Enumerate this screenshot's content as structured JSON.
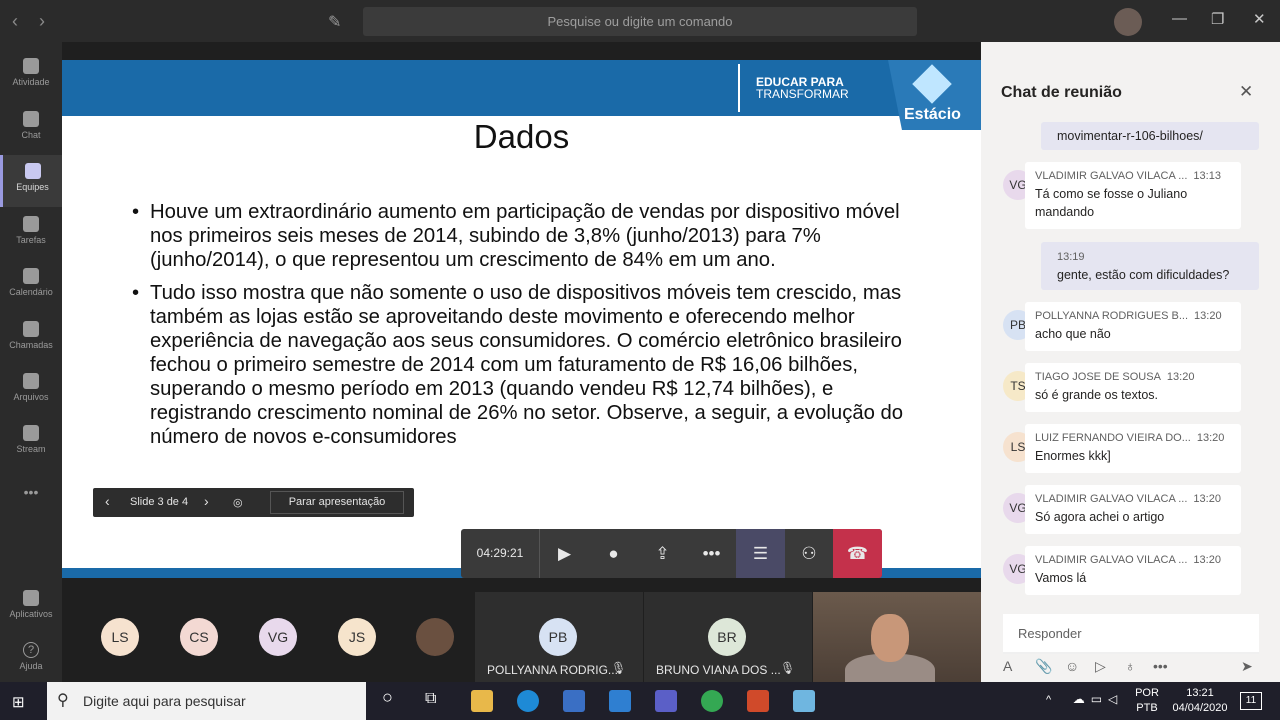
{
  "topbar": {
    "search_placeholder": "Pesquise ou digite um comando",
    "back": "‹",
    "forward": "›",
    "compose": "✎",
    "minimize": "—",
    "maximize": "❐",
    "close": "✕"
  },
  "rail": {
    "items": [
      {
        "label": "Atividade",
        "icon": "bell-icon"
      },
      {
        "label": "Chat",
        "icon": "chat-icon"
      },
      {
        "label": "Equipes",
        "icon": "teams-icon"
      },
      {
        "label": "Tarefas",
        "icon": "tasks-icon"
      },
      {
        "label": "Calendário",
        "icon": "calendar-icon"
      },
      {
        "label": "Chamadas",
        "icon": "phone-icon"
      },
      {
        "label": "Arquivos",
        "icon": "files-icon"
      },
      {
        "label": "Stream",
        "icon": "stream-icon"
      }
    ],
    "more": "•••",
    "apps": "Aplicativos",
    "help": "Ajuda",
    "help_glyph": "?"
  },
  "slide": {
    "brand_line1": "EDUCAR PARA",
    "brand_line2": "TRANSFORMAR",
    "logo_text": "Estácio",
    "title": "Dados",
    "bullet1": "Houve um extraordinário aumento em participação de vendas por dispositivo móvel nos primeiros seis meses de 2014, subindo de 3,8% (junho/2013) para 7% (junho/2014), o que representou um crescimento de 84% em um ano.",
    "bullet2": "Tudo isso mostra que não somente o uso de dispositivos móveis tem crescido, mas também as lojas estão se aproveitando deste movimento e oferecendo melhor experiência de navegação aos seus consumidores. O comércio eletrônico brasileiro fechou o primeiro semestre de 2014 com um faturamento de R$ 16,06 bilhões, superando o mesmo período em 2013 (quando vendeu R$ 12,74 bilhões), e registrando crescimento nominal de 26% no setor. Observe, a seguir, a evolução do número de novos e-consumidores"
  },
  "slide_controls": {
    "prev": "‹",
    "label": "Slide 3 de 4",
    "next": "›",
    "hide": "◎",
    "stop": "Parar apresentação"
  },
  "call_bar": {
    "timer": "04:29:21",
    "camera": "▶",
    "mic": "●",
    "share": "⇪",
    "more": "•••",
    "chat": "☰",
    "people": "⚇",
    "hangup": "☎"
  },
  "participants": {
    "circles": [
      {
        "initials": "LS",
        "color": "#f6e2cf"
      },
      {
        "initials": "CS",
        "color": "#f3d9d3"
      },
      {
        "initials": "VG",
        "color": "#e8d9ec"
      },
      {
        "initials": "JS",
        "color": "#f6e4cc"
      }
    ],
    "tiles": [
      {
        "initials": "PB",
        "name": "POLLYANNA RODRIG...",
        "color": "#d7e2f3"
      },
      {
        "initials": "BR",
        "name": "BRUNO VIANA DOS ...",
        "color": "#dde7d8"
      }
    ],
    "mute_glyph": "🎙"
  },
  "chat": {
    "title": "Chat de reunião",
    "close": "✕",
    "link_msg": "movimentar-r-106-bilhoes/",
    "messages": [
      {
        "initials": "VG",
        "author": "VLADIMIR GALVAO VILACA ...",
        "time": "13:13",
        "text": "Tá como se fosse o Juliano mandando",
        "color": "#e8d9ec"
      },
      {
        "initials": "PB",
        "author": "POLLYANNA RODRIGUES B...",
        "time": "13:20",
        "text": "acho que não",
        "color": "#d7e2f3"
      },
      {
        "initials": "TS",
        "author": "TIAGO JOSE DE SOUSA",
        "time": "13:20",
        "text": "só é grande os textos.",
        "color": "#f6e9c8"
      },
      {
        "initials": "LS",
        "author": "LUIZ FERNANDO VIEIRA DO...",
        "time": "13:20",
        "text": "Enormes kkk]",
        "color": "#f6e2cf"
      },
      {
        "initials": "VG",
        "author": "VLADIMIR GALVAO VILACA ...",
        "time": "13:20",
        "text": "Só agora achei o artigo",
        "color": "#e8d9ec"
      },
      {
        "initials": "VG",
        "author": "VLADIMIR GALVAO VILACA ...",
        "time": "13:20",
        "text": "Vamos lá",
        "color": "#e8d9ec"
      }
    ],
    "own_message": {
      "time": "13:19",
      "text": "gente, estão com dificuldades?"
    },
    "reply_placeholder": "Responder",
    "compose_icons": [
      "A",
      "📎",
      "☺",
      "▷",
      "♁",
      "•••",
      "➤"
    ]
  },
  "taskbar": {
    "start": "⊞",
    "search_placeholder": "Digite aqui para pesquisar",
    "search_glyph": "⚲",
    "cortana": "○",
    "taskview": "⧉",
    "tray_up": "^",
    "lang1": "POR",
    "lang2": "PTB",
    "time": "13:21",
    "date": "04/04/2020",
    "notif": "11"
  }
}
